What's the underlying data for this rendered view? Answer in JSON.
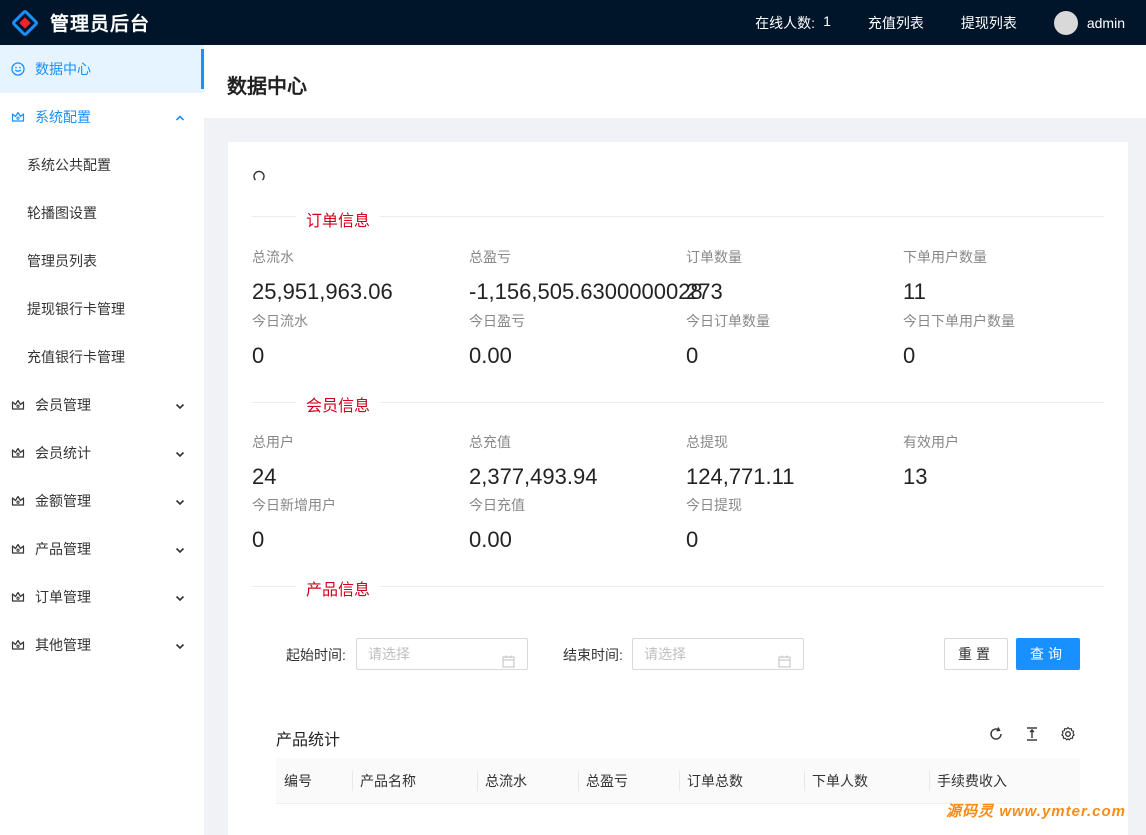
{
  "header": {
    "title": "管理员后台",
    "online_label": "在线人数:",
    "online_count": "1",
    "recharge_list": "充值列表",
    "withdraw_list": "提现列表",
    "username": "admin"
  },
  "sidebar": {
    "items": [
      {
        "label": "数据中心"
      },
      {
        "label": "系统配置"
      },
      {
        "label": "系统公共配置"
      },
      {
        "label": "轮播图设置"
      },
      {
        "label": "管理员列表"
      },
      {
        "label": "提现银行卡管理"
      },
      {
        "label": "充值银行卡管理"
      },
      {
        "label": "会员管理"
      },
      {
        "label": "会员统计"
      },
      {
        "label": "金额管理"
      },
      {
        "label": "产品管理"
      },
      {
        "label": "订单管理"
      },
      {
        "label": "其他管理"
      }
    ]
  },
  "page": {
    "title": "数据中心"
  },
  "order_section": {
    "title": "订单信息",
    "stats": [
      {
        "label": "总流水",
        "value": "25,951,963.06"
      },
      {
        "label": "总盈亏",
        "value": "-1,156,505.6300000028"
      },
      {
        "label": "订单数量",
        "value": "273"
      },
      {
        "label": "下单用户数量",
        "value": "11"
      },
      {
        "label": "今日流水",
        "value": "0"
      },
      {
        "label": "今日盈亏",
        "value": "0.00"
      },
      {
        "label": "今日订单数量",
        "value": "0"
      },
      {
        "label": "今日下单用户数量",
        "value": "0"
      }
    ]
  },
  "member_section": {
    "title": "会员信息",
    "stats": [
      {
        "label": "总用户",
        "value": "24"
      },
      {
        "label": "总充值",
        "value": "2,377,493.94"
      },
      {
        "label": "总提现",
        "value": "124,771.11"
      },
      {
        "label": "有效用户",
        "value": "13"
      },
      {
        "label": "今日新增用户",
        "value": "0"
      },
      {
        "label": "今日充值",
        "value": "0.00"
      },
      {
        "label": "今日提现",
        "value": "0"
      }
    ]
  },
  "product_section": {
    "title": "产品信息",
    "start_label": "起始时间:",
    "end_label": "结束时间:",
    "placeholder": "请选择",
    "reset_label": "重置",
    "query_label": "查询",
    "table_title": "产品统计",
    "columns": [
      "编号",
      "产品名称",
      "总流水",
      "总盈亏",
      "订单总数",
      "下单人数",
      "手续费收入"
    ]
  },
  "watermark": "源码灵 www.ymter.com",
  "colors": {
    "accent": "#1890ff",
    "section_title": "#d0021b",
    "header_bg": "#001529"
  }
}
